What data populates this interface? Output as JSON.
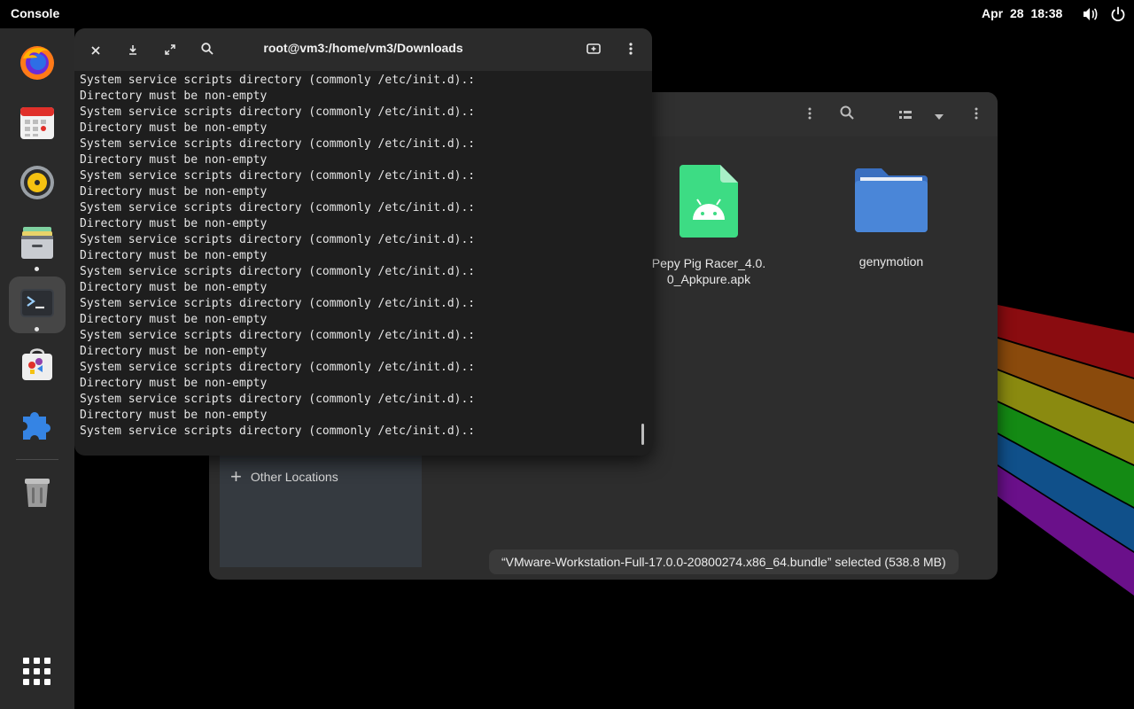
{
  "topbar": {
    "activity_label": "Console",
    "clock": "Apr 28  18:38",
    "icons": [
      "volume-icon",
      "power-icon"
    ]
  },
  "dash": {
    "apps": [
      {
        "name": "Firefox",
        "icon": "firefox-icon",
        "running": false
      },
      {
        "name": "Calendar",
        "icon": "calendar-icon",
        "running": false
      },
      {
        "name": "Rhythmbox",
        "icon": "music-icon",
        "running": false
      },
      {
        "name": "Files",
        "icon": "files-icon",
        "running": true
      },
      {
        "name": "Console",
        "icon": "terminal-icon",
        "running": true,
        "active": true
      },
      {
        "name": "Software",
        "icon": "software-icon",
        "running": false
      },
      {
        "name": "Extensions",
        "icon": "extensions-icon",
        "running": false
      },
      {
        "name": "Trash",
        "icon": "trash-icon",
        "running": false
      }
    ],
    "show_apps_icon": "app-grid-icon"
  },
  "terminal": {
    "title": "root@vm3:/home/vm3/Downloads",
    "lines": [
      "System service scripts directory (commonly /etc/init.d).:",
      "Directory must be non-empty",
      "System service scripts directory (commonly /etc/init.d).:",
      "Directory must be non-empty",
      "System service scripts directory (commonly /etc/init.d).:",
      "Directory must be non-empty",
      "System service scripts directory (commonly /etc/init.d).:",
      "Directory must be non-empty",
      "System service scripts directory (commonly /etc/init.d).:",
      "Directory must be non-empty",
      "System service scripts directory (commonly /etc/init.d).:",
      "Directory must be non-empty",
      "System service scripts directory (commonly /etc/init.d).:",
      "Directory must be non-empty",
      "System service scripts directory (commonly /etc/init.d).:",
      "Directory must be non-empty",
      "System service scripts directory (commonly /etc/init.d).:",
      "Directory must be non-empty",
      "System service scripts directory (commonly /etc/init.d).:",
      "Directory must be non-empty",
      "System service scripts directory (commonly /etc/init.d).:",
      "Directory must be non-empty",
      "System service scripts directory (commonly /etc/init.d).:"
    ]
  },
  "files": {
    "sidebar": {
      "other_locations": "Other Locations"
    },
    "items": [
      {
        "name": "Pepy Pig Racer_4.0.0_Apkpure.apk",
        "icon": "android-apk-icon"
      },
      {
        "name": "genymotion",
        "icon": "folder-icon"
      }
    ],
    "status": "“VMware-Workstation-Full-17.0.0-20800274.x86_64.bundle” selected  (538.8 MB)"
  },
  "colors": {
    "dash_bg": "#2a2a2a",
    "terminal_bg": "#1e1e1e",
    "files_bg": "#2d2d2d",
    "android_green": "#3ddc84",
    "folder_blue": "#4a86d8"
  }
}
